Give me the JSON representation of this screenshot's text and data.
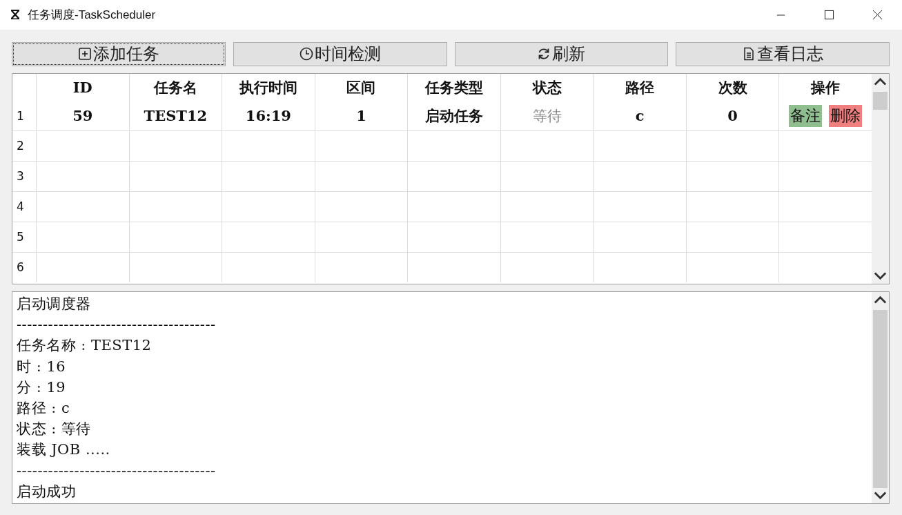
{
  "window": {
    "title": "任务调度-TaskScheduler"
  },
  "toolbar": [
    {
      "kind": "add",
      "label": "添加任务",
      "focused": true
    },
    {
      "kind": "clock",
      "label": "时间检测",
      "focused": false
    },
    {
      "kind": "refresh",
      "label": "刷新",
      "focused": false
    },
    {
      "kind": "log",
      "label": "查看日志",
      "focused": false
    }
  ],
  "table": {
    "columns": [
      "ID",
      "任务名",
      "执行时间",
      "区间",
      "任务类型",
      "状态",
      "路径",
      "次数",
      "操作"
    ],
    "rows": [
      {
        "number": "1",
        "cells": [
          "59",
          "TEST12",
          "16:19",
          "1",
          "启动任务",
          "等待",
          "c",
          "0"
        ],
        "actions": [
          {
            "kind": "note",
            "label": "备注"
          },
          {
            "kind": "delete",
            "label": "删除"
          }
        ]
      },
      {
        "number": "2",
        "cells": [],
        "actions": []
      },
      {
        "number": "3",
        "cells": [],
        "actions": []
      },
      {
        "number": "4",
        "cells": [],
        "actions": []
      },
      {
        "number": "5",
        "cells": [],
        "actions": []
      },
      {
        "number": "6",
        "cells": [],
        "actions": []
      }
    ]
  },
  "log": {
    "lines": [
      "启动调度器",
      "--------------------------------------",
      "任务名称 : TEST12",
      "时 : 16",
      "分 : 19",
      "路径 : c",
      "状态 : 等待",
      "装载 JOB .....",
      "--------------------------------------",
      "启动成功"
    ]
  }
}
